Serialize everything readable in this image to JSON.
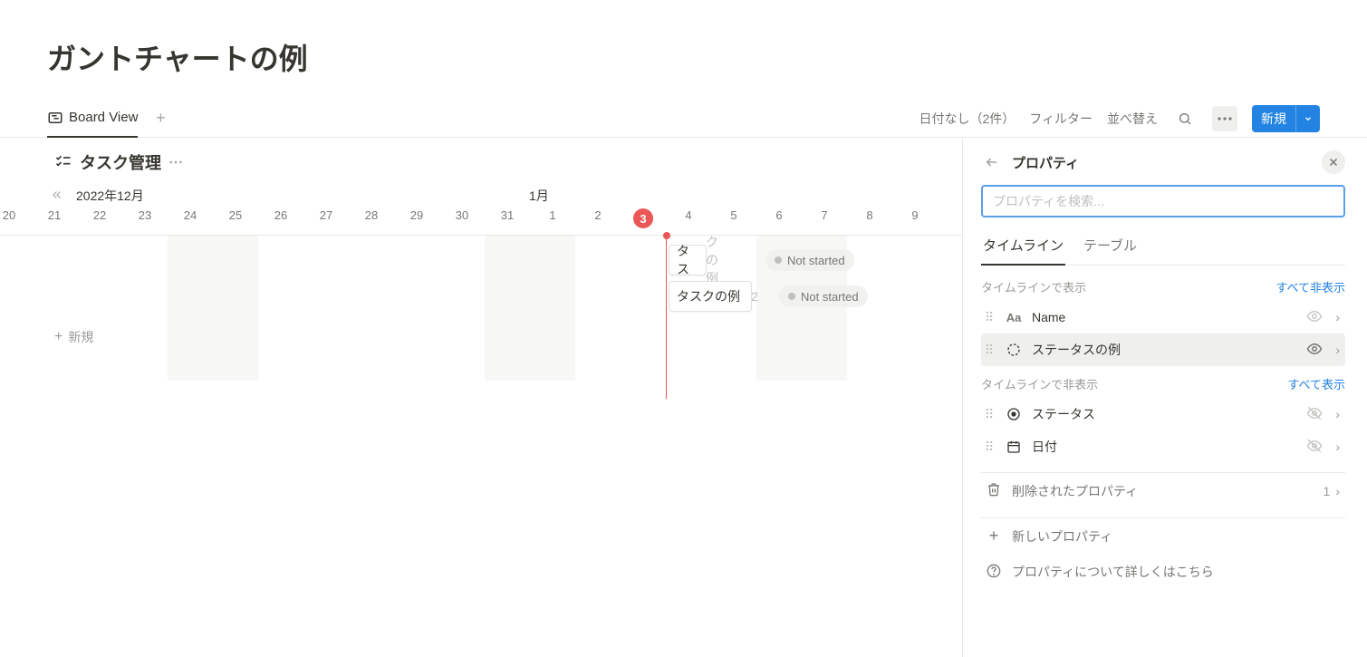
{
  "page": {
    "title": "ガントチャートの例"
  },
  "toolbar": {
    "view_tab": "Board View",
    "no_date": "日付なし（2件）",
    "filter": "フィルター",
    "sort": "並べ替え",
    "new_label": "新規"
  },
  "subheader": {
    "title": "タスク管理"
  },
  "timeline": {
    "months": {
      "left": "2022年12月",
      "right": "1月"
    },
    "days": [
      "20",
      "21",
      "22",
      "23",
      "24",
      "25",
      "26",
      "27",
      "28",
      "29",
      "30",
      "31",
      "1",
      "2",
      "3",
      "4",
      "5",
      "6",
      "7",
      "8",
      "9"
    ],
    "today_index": 14,
    "tasks": [
      {
        "label_visible": "タス",
        "label_overflow": "クの例",
        "status": "Not started"
      },
      {
        "label_visible": "タスクの例",
        "label_overflow": "2",
        "status": "Not started"
      }
    ],
    "new_row": "新規"
  },
  "panel": {
    "title": "プロパティ",
    "search_placeholder": "プロパティを検索...",
    "tabs": {
      "timeline": "タイムライン",
      "table": "テーブル"
    },
    "section_shown": {
      "head": "タイムラインで表示",
      "action": "すべて非表示"
    },
    "section_hidden": {
      "head": "タイムラインで非表示",
      "action": "すべて表示"
    },
    "props_shown": [
      {
        "label": "Name",
        "icon": "Aa"
      },
      {
        "label": "ステータスの例",
        "icon": "status"
      }
    ],
    "props_hidden": [
      {
        "label": "ステータス",
        "icon": "target"
      },
      {
        "label": "日付",
        "icon": "calendar"
      }
    ],
    "deleted": {
      "label": "削除されたプロパティ",
      "count": "1"
    },
    "new_prop": "新しいプロパティ",
    "learn_more": "プロパティについて詳しくはこちら"
  }
}
